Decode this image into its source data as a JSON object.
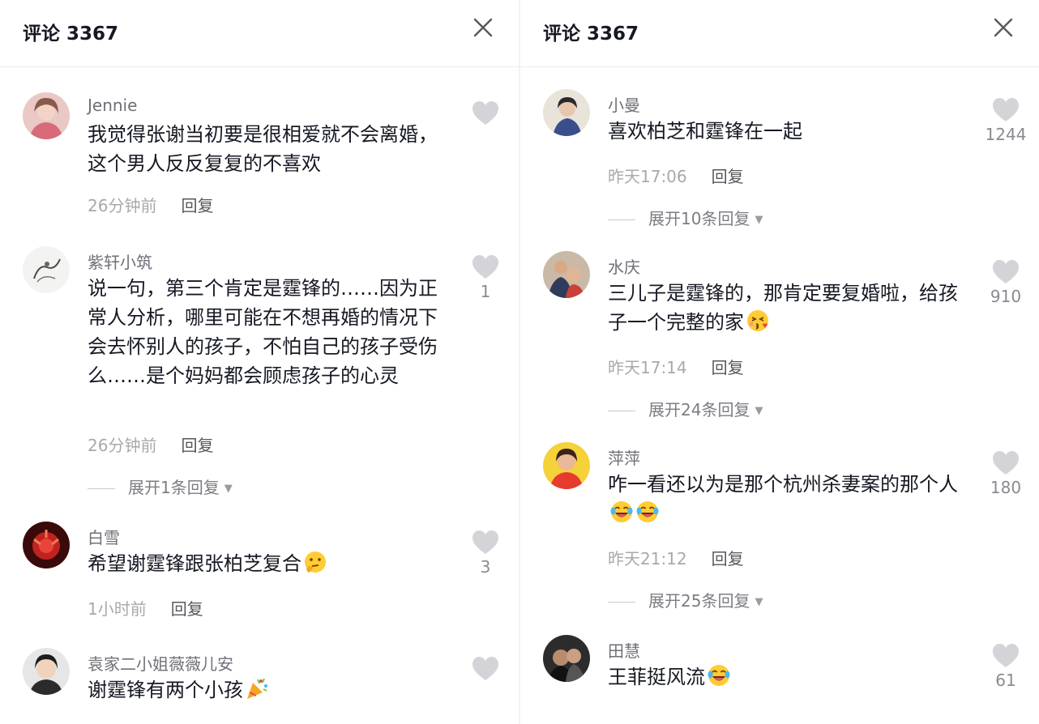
{
  "left_panel": {
    "title": "评论 3367",
    "comments": [
      {
        "user": "Jennie",
        "text": "我觉得张谢当初要是很相爱就不会离婚，这个男人反反复复的不喜欢",
        "time": "26分钟前",
        "reply_label": "回复",
        "likes": ""
      },
      {
        "user": "紫轩小筑",
        "text": "说一句，第三个肯定是霆锋的……因为正常人分析，哪里可能在不想再婚的情况下会去怀别人的孩子，不怕自己的孩子受伤么……是个妈妈都会顾虑孩子的心灵",
        "time": "26分钟前",
        "reply_label": "回复",
        "likes": "1",
        "expand_label": "展开1条回复"
      },
      {
        "user": "白雪",
        "text": "希望谢霆锋跟张柏芝复合",
        "emoji": "thinking-face-emoji",
        "time": "1小时前",
        "reply_label": "回复",
        "likes": "3"
      },
      {
        "user": "袁家二小姐薇薇儿安",
        "text": "谢霆锋有两个小孩",
        "emoji": "party-popper-emoji",
        "likes": ""
      }
    ]
  },
  "right_panel": {
    "title": "评论 3367",
    "comments": [
      {
        "user": "小曼",
        "text": "喜欢柏芝和霆锋在一起",
        "time": "昨天17:06",
        "reply_label": "回复",
        "likes": "1244",
        "expand_label": "展开10条回复"
      },
      {
        "user": "水庆",
        "text": "三儿子是霆锋的，那肯定要复婚啦，给孩子一个完整的家",
        "emoji": "kissing-face-emoji",
        "time": "昨天17:14",
        "reply_label": "回复",
        "likes": "910",
        "expand_label": "展开24条回复"
      },
      {
        "user": "萍萍",
        "text": "咋一看还以为是那个杭州杀妻案的那个人",
        "emoji": "laughing-tears-emoji",
        "time": "昨天21:12",
        "reply_label": "回复",
        "likes": "180",
        "expand_label": "展开25条回复"
      },
      {
        "user": "田慧",
        "text": "王菲挺风流",
        "emoji": "laughing-tears-emoji",
        "likes": "61"
      }
    ]
  },
  "colors": {
    "text_primary": "#161823",
    "text_username": "#6f7077",
    "text_time": "#a8a9ad",
    "like_icon": "#d4d4d8",
    "divider": "#ececee"
  }
}
